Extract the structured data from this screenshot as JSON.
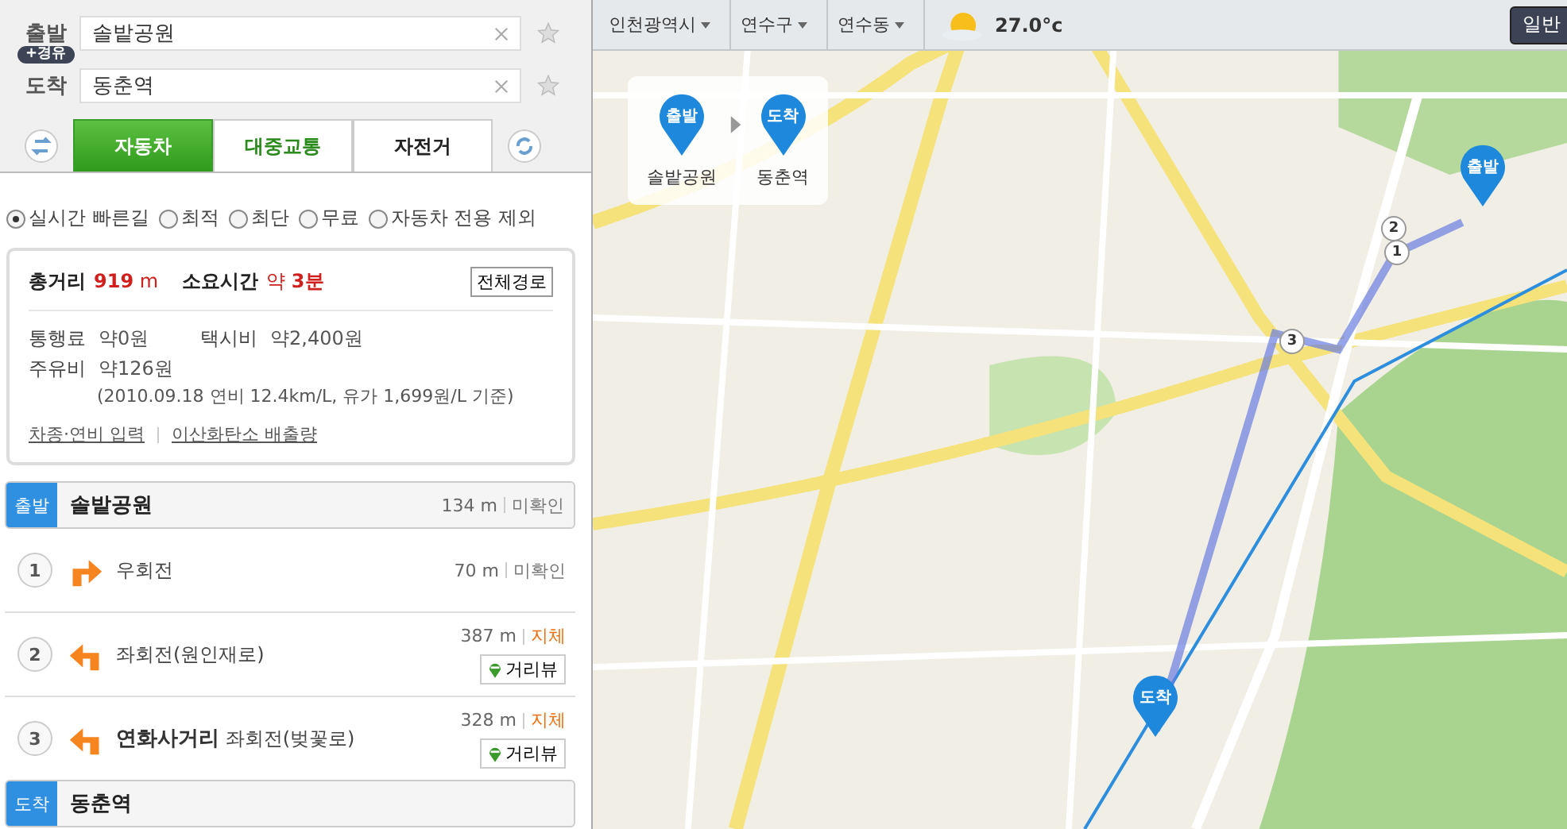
{
  "route_form": {
    "origin": {
      "label": "출발",
      "value": "솔밭공원"
    },
    "waypoint_button": "+경유",
    "destination": {
      "label": "도착",
      "value": "동춘역"
    }
  },
  "modes": [
    {
      "label": "자동차",
      "selected": true
    },
    {
      "label": "대중교통",
      "selected": false
    },
    {
      "label": "자전거",
      "selected": false
    }
  ],
  "route_options": [
    {
      "label": "실시간 빠른길",
      "selected": true
    },
    {
      "label": "최적",
      "selected": false
    },
    {
      "label": "최단",
      "selected": false
    },
    {
      "label": "무료",
      "selected": false
    },
    {
      "label": "자동차 전용 제외",
      "selected": false
    }
  ],
  "summary": {
    "distance_label": "총거리",
    "distance": "919",
    "distance_unit": "m",
    "time_label": "소요시간",
    "time_prefix": "약",
    "time": "3분",
    "full_route_button": "전체경로",
    "toll_label": "통행료",
    "toll": "약0원",
    "taxi_label": "택시비",
    "taxi": "약2,400원",
    "fuel_label": "주유비",
    "fuel": "약126원",
    "fuel_note": "(2010.09.18 연비 12.4km/L, 유가 1,699원/L 기준)",
    "links": [
      "차종·연비 입력",
      "이산화탄소 배출량"
    ]
  },
  "start": {
    "badge": "출발",
    "name": "솔밭공원",
    "distance": "134 m",
    "traffic": {
      "label": "미확인",
      "color": "#777777"
    }
  },
  "steps": [
    {
      "number": "1",
      "kind": "right",
      "instruction": "우회전",
      "distance": "70 m",
      "traffic": {
        "label": "미확인",
        "color": "#777777"
      }
    },
    {
      "number": "2",
      "kind": "left",
      "instruction": "좌회전(원인재로)",
      "distance": "387 m",
      "traffic": {
        "label": "지체",
        "color": "#f07010"
      },
      "street_view_button": "거리뷰"
    },
    {
      "number": "3",
      "kind": "left",
      "place": "연화사거리",
      "instruction": "좌회전(벚꽃로)",
      "distance": "328 m",
      "traffic": {
        "label": "지체",
        "color": "#f07010"
      },
      "street_view_button": "거리뷰"
    }
  ],
  "end": {
    "badge": "도착",
    "name": "동춘역"
  },
  "map": {
    "breadcrumbs": [
      "인천광역시",
      "연수구",
      "연수동"
    ],
    "temperature": "27.0°c",
    "map_type_button": "일반",
    "route_card": [
      {
        "badge": "출발",
        "name": "솔밭공원"
      },
      {
        "badge": "도착",
        "name": "동춘역"
      }
    ],
    "pins": [
      {
        "kind": "origin",
        "label": "출발"
      },
      {
        "kind": "destination",
        "label": "도착"
      }
    ],
    "route_markers": [
      "1",
      "2",
      "3"
    ]
  }
}
